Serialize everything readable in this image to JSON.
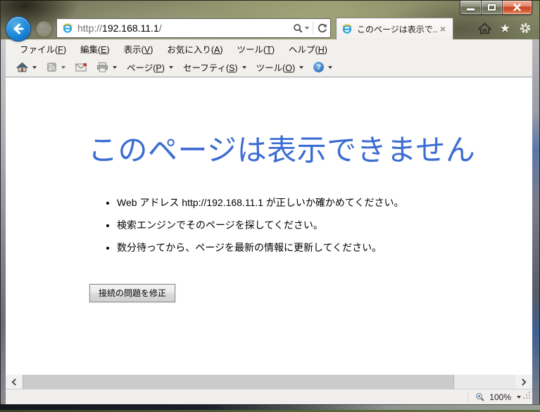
{
  "nav": {
    "url_scheme": "http://",
    "url_host": "192.168.11.1",
    "url_path": "/",
    "tab_title": "このページは表示で...",
    "tab_close_glyph": "×"
  },
  "menu_bar": {
    "items": [
      {
        "pre": "ファイル(",
        "key": "F",
        "post": ")"
      },
      {
        "pre": "編集(",
        "key": "E",
        "post": ")"
      },
      {
        "pre": "表示(",
        "key": "V",
        "post": ")"
      },
      {
        "pre": "お気に入り(",
        "key": "A",
        "post": ")"
      },
      {
        "pre": "ツール(",
        "key": "T",
        "post": ")"
      },
      {
        "pre": "ヘルプ(",
        "key": "H",
        "post": ")"
      }
    ]
  },
  "command_bar": {
    "page_menu": {
      "pre": "ページ(",
      "key": "P",
      "post": ")"
    },
    "safety_menu": {
      "pre": "セーフティ(",
      "key": "S",
      "post": ")"
    },
    "tools_menu": {
      "pre": "ツール(",
      "key": "O",
      "post": ")"
    },
    "help_glyph": "?"
  },
  "content": {
    "heading": "このページは表示できません",
    "bullets": [
      "Web アドレス http://192.168.11.1 が正しいか確かめてください。",
      "検索エンジンでそのページを探してください。",
      "数分待ってから、ページを最新の情報に更新してください。"
    ],
    "fix_button_label": "接続の問題を修正"
  },
  "status_bar": {
    "zoom_level": "100%"
  },
  "icons": {
    "star_glyph": "★"
  },
  "colors": {
    "heading_blue": "#3c6cd3",
    "back_button_blue": "#1b86d9",
    "close_button_red": "#c94323",
    "chrome_bar_gray": "#f2f0ed"
  }
}
